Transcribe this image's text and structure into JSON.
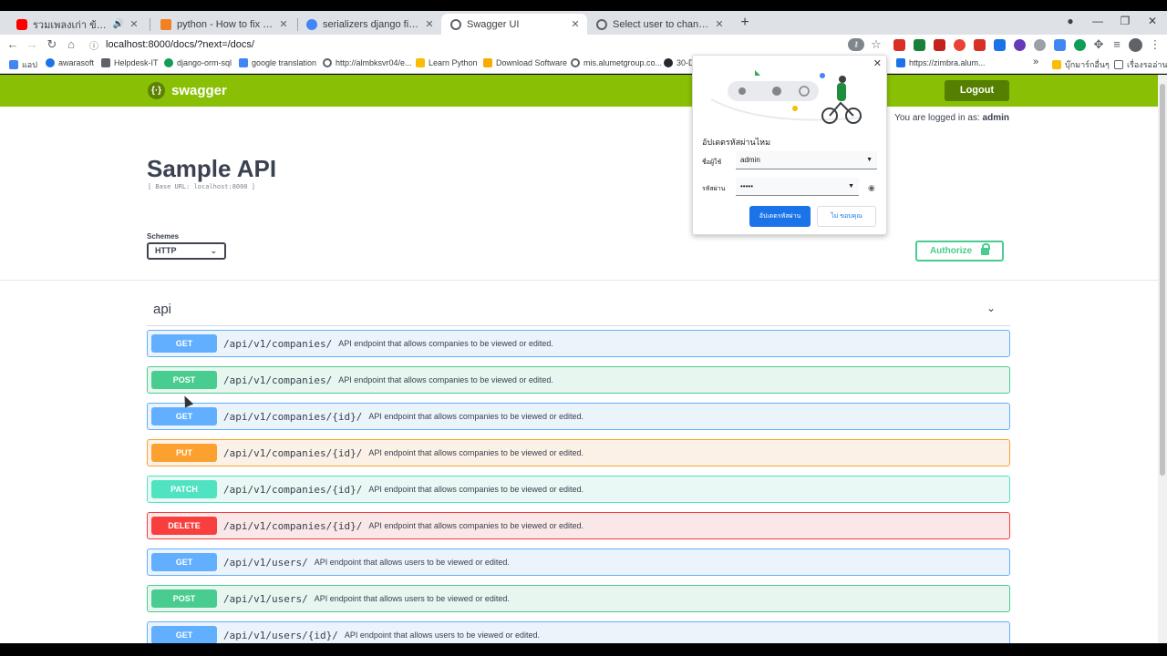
{
  "browser": {
    "tabs": [
      {
        "title": "รวมเพลงเก่า ข้าวุ เพลารุ เศร้าๆ ฝั่ง",
        "icon": "youtube-icon",
        "color": "#ff0000"
      },
      {
        "title": "python - How to fix \" AttributeEr",
        "icon": "stackoverflow-icon",
        "color": "#f48024"
      },
      {
        "title": "serializers django field name - Go",
        "icon": "google-icon",
        "color": "#4285f4"
      },
      {
        "title": "Swagger UI",
        "icon": "globe-icon",
        "color": "#5f6368"
      },
      {
        "title": "Select user to change | Django si",
        "icon": "globe-icon",
        "color": "#5f6368"
      }
    ],
    "url": "localhost:8000/docs/?next=/docs/",
    "bookmarks": [
      "แอป",
      "awarasoft",
      "Helpdesk-IT",
      "django-orm-sql",
      "google translation",
      "http://almbksvr04/e...",
      "Learn Python",
      "Download Software",
      "mis.alumetgroup.co...",
      "30-D",
      "https://zimbra.alum...",
      "»",
      "บุ๊กมาร์กอื่นๆ",
      "เรื่องรออ่าน"
    ]
  },
  "swagger": {
    "brand": "swagger",
    "logout_label": "Logout",
    "logged_in_prefix": "You are logged in as:",
    "logged_in_user": "admin",
    "title": "Sample API",
    "base_url": "[ Base URL: localhost:8000 ]",
    "schemes_label": "Schemes",
    "scheme_value": "HTTP",
    "authorize_label": "Authorize",
    "tag_name": "api",
    "operations": [
      {
        "method": "GET",
        "path": "/api/v1/companies/",
        "desc": "API endpoint that allows companies to be viewed or edited."
      },
      {
        "method": "POST",
        "path": "/api/v1/companies/",
        "desc": "API endpoint that allows companies to be viewed or edited."
      },
      {
        "method": "GET",
        "path": "/api/v1/companies/{id}/",
        "desc": "API endpoint that allows companies to be viewed or edited."
      },
      {
        "method": "PUT",
        "path": "/api/v1/companies/{id}/",
        "desc": "API endpoint that allows companies to be viewed or edited."
      },
      {
        "method": "PATCH",
        "path": "/api/v1/companies/{id}/",
        "desc": "API endpoint that allows companies to be viewed or edited."
      },
      {
        "method": "DELETE",
        "path": "/api/v1/companies/{id}/",
        "desc": "API endpoint that allows companies to be viewed or edited."
      },
      {
        "method": "GET",
        "path": "/api/v1/users/",
        "desc": "API endpoint that allows users to be viewed or edited."
      },
      {
        "method": "POST",
        "path": "/api/v1/users/",
        "desc": "API endpoint that allows users to be viewed or edited."
      },
      {
        "method": "GET",
        "path": "/api/v1/users/{id}/",
        "desc": "API endpoint that allows users to be viewed or edited."
      }
    ]
  },
  "password_popup": {
    "title": "อัปเดตรหัสผ่านไหม",
    "username_label": "ชื่อผู้ใช้",
    "username_value": "admin",
    "password_label": "รหัสผ่าน",
    "password_value": "•••••",
    "update_label": "อัปเดตรหัสผ่าน",
    "no_thanks_label": "ไม่ ขอบคุณ"
  }
}
